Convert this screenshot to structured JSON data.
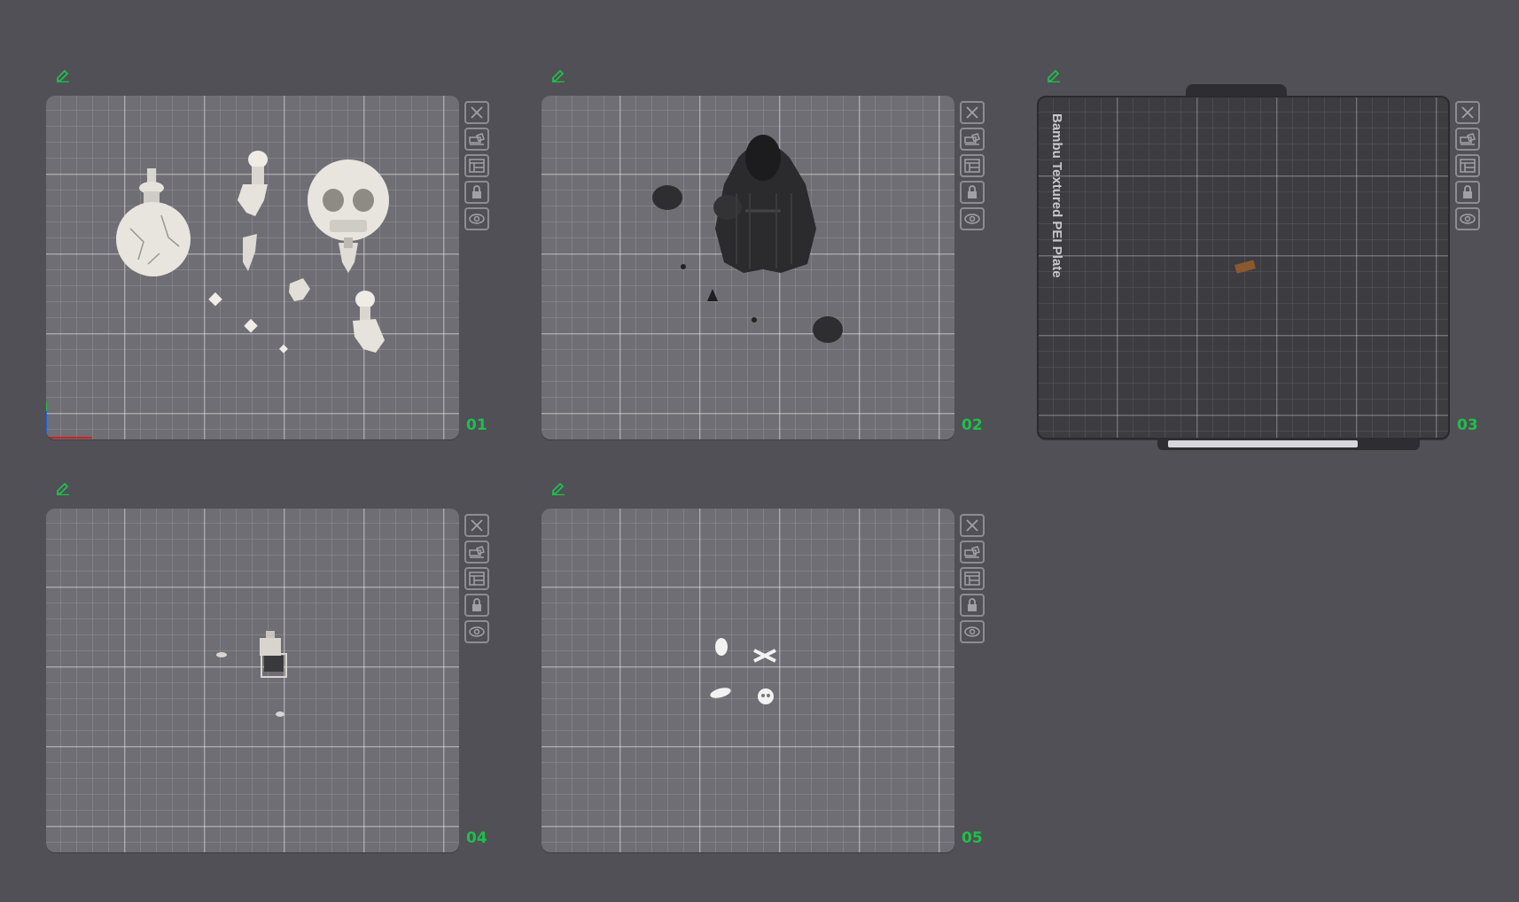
{
  "plates": [
    {
      "number": "01",
      "bed_type": "",
      "edit_icon": "pencil-icon"
    },
    {
      "number": "02",
      "bed_type": "",
      "edit_icon": "pencil-icon"
    },
    {
      "number": "03",
      "bed_type": "Bambu Textured PEI Plate",
      "edit_icon": "pencil-icon"
    },
    {
      "number": "04",
      "bed_type": "",
      "edit_icon": "pencil-icon"
    },
    {
      "number": "05",
      "bed_type": "",
      "edit_icon": "pencil-icon"
    }
  ],
  "toolbar_icons": [
    "close-icon",
    "orient-icon",
    "arrange-icon",
    "lock-icon",
    "eye-icon"
  ],
  "colors": {
    "background": "#505056",
    "plate_number": "#1fbf4a",
    "edit_icon": "#1fbf4a",
    "bed_light": "#6e6e74",
    "bed_dark": "#3c3c41",
    "axis_x": "#d02020",
    "axis_y": "#2060e0",
    "axis_z": "#20c040"
  }
}
